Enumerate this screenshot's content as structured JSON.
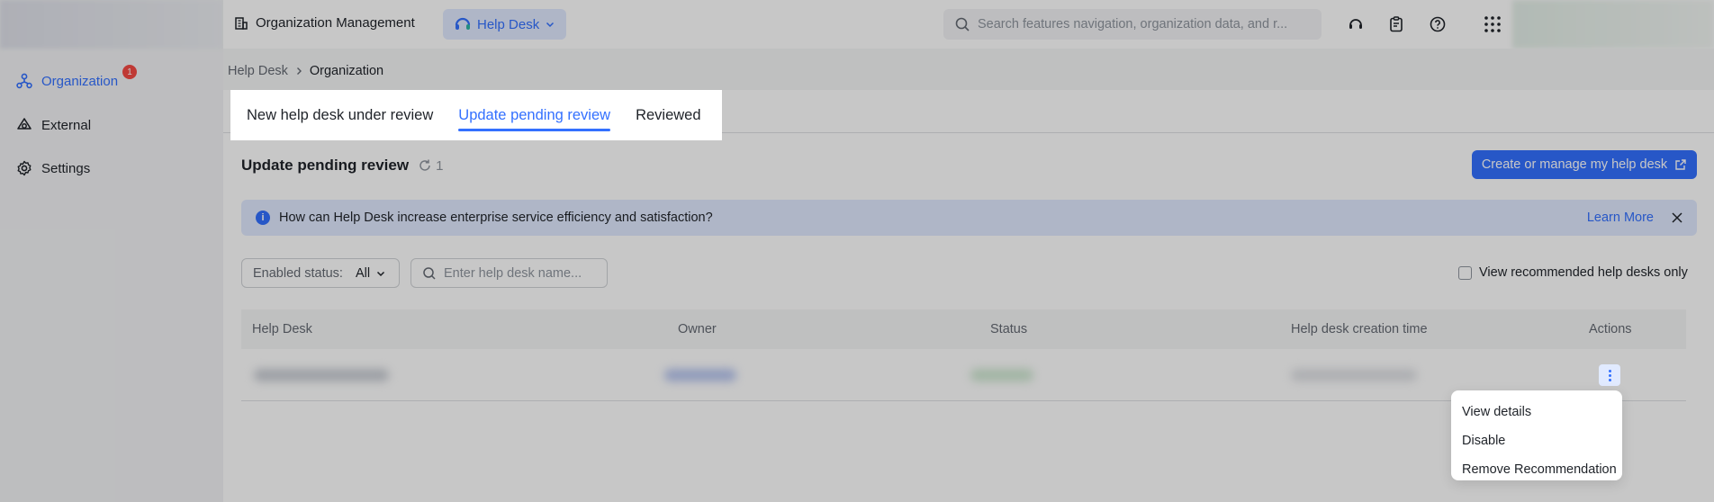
{
  "sidebar": {
    "items": [
      {
        "label": "Organization",
        "badge": "1",
        "active": true
      },
      {
        "label": "External"
      },
      {
        "label": "Settings"
      }
    ]
  },
  "header": {
    "app_title": "Organization Management",
    "app_switch": "Help Desk",
    "search_placeholder": "Search features navigation, organization data, and r..."
  },
  "breadcrumb": {
    "parent": "Help Desk",
    "current": "Organization"
  },
  "tabs": [
    {
      "label": "New help desk under review"
    },
    {
      "label": "Update pending review",
      "active": true
    },
    {
      "label": "Reviewed"
    }
  ],
  "section": {
    "title": "Update pending review",
    "count": "1",
    "create_button": "Create or manage my help desk"
  },
  "notice": {
    "text": "How can Help Desk increase enterprise service efficiency and satisfaction?",
    "link": "Learn More"
  },
  "filters": {
    "status_label": "Enabled status:",
    "status_value": "All",
    "search_placeholder": "Enter help desk name...",
    "recommended_only": "View recommended help desks only"
  },
  "table": {
    "columns": [
      "Help Desk",
      "Owner",
      "Status",
      "Help desk creation time",
      "Actions"
    ]
  },
  "row_menu": [
    "View details",
    "Disable",
    "Remove Recommendation"
  ],
  "colors": {
    "accent": "#3370ff",
    "badge": "#f54a45"
  }
}
